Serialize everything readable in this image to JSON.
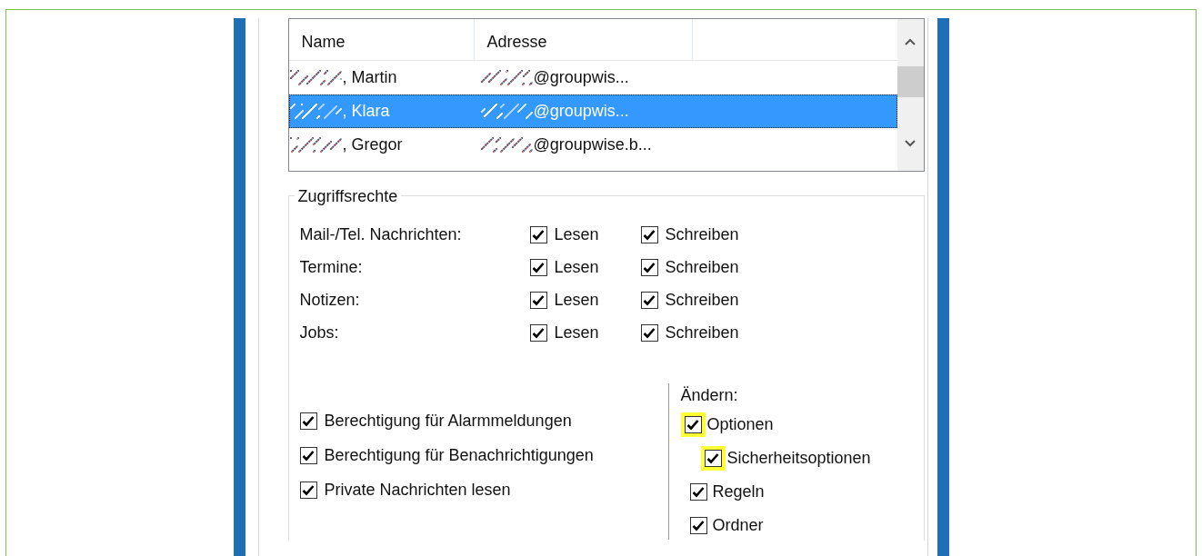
{
  "contacts_list": {
    "columns": [
      "Name",
      "Adresse"
    ],
    "rows": [
      {
        "name": ", Martin",
        "address": "@groupwis...",
        "obscured": true,
        "selected": false
      },
      {
        "name": ", Klara",
        "address": "@groupwis...",
        "obscured": true,
        "selected": true
      },
      {
        "name": ", Gregor",
        "address": "@groupwise.b...",
        "obscured": true,
        "selected": false
      }
    ]
  },
  "access_rights": {
    "title": "Zugriffsrechte",
    "rows": [
      {
        "label": "Mail-/Tel. Nachrichten:",
        "read": {
          "label": "Lesen",
          "checked": true
        },
        "write": {
          "label": "Schreiben",
          "checked": true
        }
      },
      {
        "label": "Termine:",
        "read": {
          "label": "Lesen",
          "checked": true
        },
        "write": {
          "label": "Schreiben",
          "checked": true
        }
      },
      {
        "label": "Notizen:",
        "read": {
          "label": "Lesen",
          "checked": true
        },
        "write": {
          "label": "Schreiben",
          "checked": true
        }
      },
      {
        "label": "Jobs:",
        "read": {
          "label": "Lesen",
          "checked": true
        },
        "write": {
          "label": "Schreiben",
          "checked": true
        }
      }
    ],
    "permissions": [
      {
        "label": "Berechtigung für Alarmmeldungen",
        "checked": true
      },
      {
        "label": "Berechtigung für Benachrichtigungen",
        "checked": true
      },
      {
        "label": "Private Nachrichten lesen",
        "checked": true
      }
    ],
    "change": {
      "title": "Ändern:",
      "items": [
        {
          "label": "Optionen",
          "checked": true,
          "highlighted": true,
          "children": [
            {
              "label": "Sicherheitsoptionen",
              "checked": true,
              "highlighted": true
            }
          ]
        },
        {
          "label": "Regeln",
          "checked": true
        },
        {
          "label": "Ordner",
          "checked": true
        }
      ]
    }
  }
}
